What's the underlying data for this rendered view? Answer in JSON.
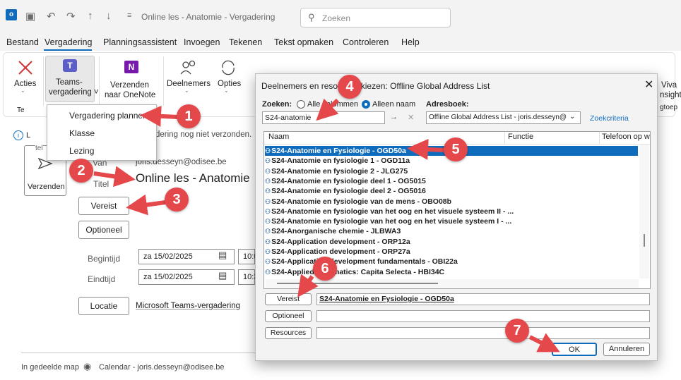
{
  "titlebar": {
    "title": "Online les - Anatomie  -  Vergadering",
    "search_placeholder": "Zoeken"
  },
  "menu": {
    "tabs": [
      "Bestand",
      "Vergadering",
      "Planningsassistent",
      "Invoegen",
      "Tekenen",
      "Tekst opmaken",
      "Controleren",
      "Help"
    ]
  },
  "ribbon": {
    "acties": "Acties",
    "teams_line1": "Teams-",
    "teams_line2": "vergadering ˅",
    "onenote_line1": "Verzenden",
    "onenote_line2": "naar OneNote",
    "deelnemers": "Deelnemers",
    "opties": "Opties",
    "viva_line1": "Viva",
    "viva_line2": "nsight",
    "viva_line3": "gtoep",
    "group_label": "Te"
  },
  "dropdown": {
    "items": [
      "Vergadering plannen",
      "Klasse",
      "Lezing"
    ]
  },
  "compose": {
    "info_text": "dering nog niet verzonden.",
    "info_prefix": "i",
    "info_letter": "L",
    "send_label": "Verzenden",
    "send_group": "tel",
    "from_label": "Van",
    "from_value": "joris.desseyn@odisee.be",
    "title_label": "Titel",
    "title_value": "Online les - Anatomie",
    "vereist_button": "Vereist",
    "optioneel_button": "Optioneel",
    "begintijd_label": "Begintijd",
    "begintijd_value": "za 15/02/2025",
    "begintijd_time": "10:0",
    "eindtijd_label": "Eindtijd",
    "eindtijd_value": "za 15/02/2025",
    "eindtijd_time": "10:3",
    "locatie_button": "Locatie",
    "locatie_value": "Microsoft Teams-vergadering",
    "shared_folder_label": "In gedeelde map",
    "calendar_label": "Calendar - joris.desseyn@odisee.be"
  },
  "dialog": {
    "title": "Deelnemers en resources kiezen: Offline Global Address List",
    "zoeken_label": "Zoeken:",
    "radio_all": "Alle kolommen",
    "radio_name": "Alleen naam",
    "adresboek_label": "Adresboek:",
    "search_value": "S24-anatomie",
    "addressbook_value": "Offline Global Address List - joris.desseyn@",
    "zoekcriteria_link": "Zoekcriteria",
    "col_naam": "Naam",
    "col_functie": "Functie",
    "col_telefoon": "Telefoon op w",
    "rows": [
      "S24-Anatomie en Fysiologie - OGD50a",
      "S24-Anatomie en fysiologie 1 - OGD11a",
      "S24-Anatomie en fysiologie 2 - JLG275",
      "S24-Anatomie en fysiologie deel 1 - OG5015",
      "S24-Anatomie en fysiologie deel 2 - OG5016",
      "S24-Anatomie en fysiologie van de mens - OBO08b",
      "S24-Anatomie en fysiologie van het oog en het visuele systeem II - ...",
      "S24-Anatomie en fysiologie van het oog en het visuele systeem I - ...",
      "S24-Anorganische chemie - JLBWA3",
      "S24-Application development - ORP12a",
      "S24-Application development - ORP27a",
      "S24-Application development fundamentals - OBI22a",
      "S24-Applied Informatics: Capita Selecta - HBI34C"
    ],
    "selected_index": 0,
    "vereist_button": "Vereist",
    "vereist_value": "S24-Anatomie en Fysiologie - OGD50a",
    "optioneel_button": "Optioneel",
    "resources_button": "Resources",
    "ok_button": "OK",
    "cancel_button": "Annuleren"
  },
  "callouts": [
    "1",
    "2",
    "3",
    "4",
    "5",
    "6",
    "7"
  ],
  "colors": {
    "accent": "#0f6cbd",
    "callout": "#e4484b"
  }
}
